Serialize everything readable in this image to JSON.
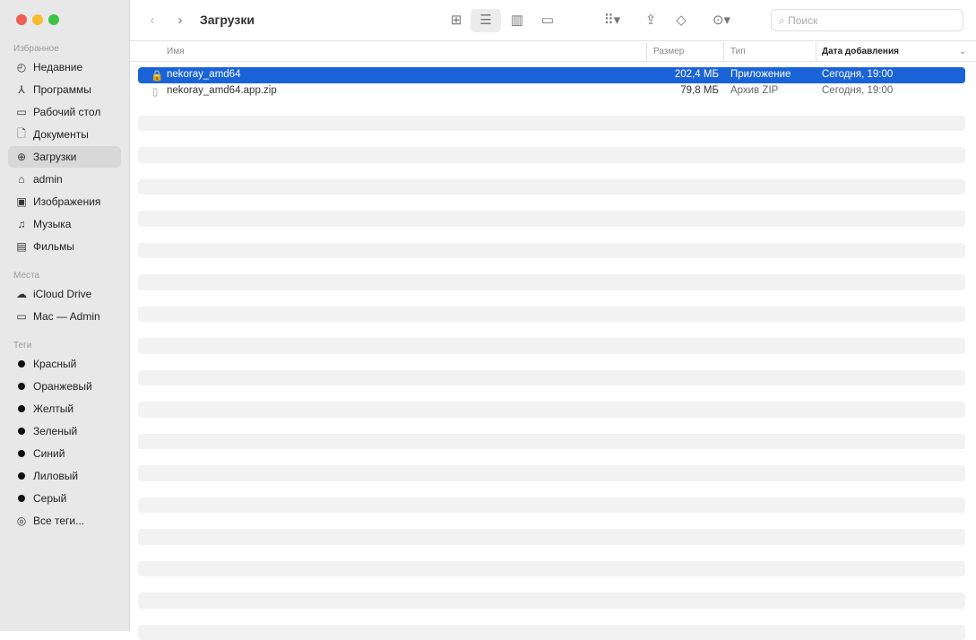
{
  "window": {
    "title": "Загрузки"
  },
  "sidebar": {
    "favorites_label": "Избранное",
    "favorites": [
      {
        "label": "Недавние",
        "icon": "clock-icon"
      },
      {
        "label": "Программы",
        "icon": "apps-icon"
      },
      {
        "label": "Рабочий стол",
        "icon": "desktop-icon"
      },
      {
        "label": "Документы",
        "icon": "document-icon"
      },
      {
        "label": "Загрузки",
        "icon": "download-icon",
        "selected": true
      },
      {
        "label": "admin",
        "icon": "home-icon"
      },
      {
        "label": "Изображения",
        "icon": "photo-icon"
      },
      {
        "label": "Музыка",
        "icon": "music-icon"
      },
      {
        "label": "Фильмы",
        "icon": "film-icon"
      }
    ],
    "places_label": "Места",
    "places": [
      {
        "label": "iCloud Drive",
        "icon": "cloud-icon"
      },
      {
        "label": "Mac — Admin",
        "icon": "computer-icon"
      }
    ],
    "tags_label": "Теги",
    "tags": [
      {
        "label": "Красный"
      },
      {
        "label": "Оранжевый"
      },
      {
        "label": "Желтый"
      },
      {
        "label": "Зеленый"
      },
      {
        "label": "Синий"
      },
      {
        "label": "Лиловый"
      },
      {
        "label": "Серый"
      }
    ],
    "all_tags": "Все теги..."
  },
  "toolbar": {
    "search_placeholder": "Поиск"
  },
  "columns": {
    "name": "Имя",
    "size": "Размер",
    "kind": "Тип",
    "date": "Дата добавления"
  },
  "files": [
    {
      "name": "nekoray_amd64",
      "size": "202,4 МБ",
      "kind": "Приложение",
      "date": "Сегодня, 19:00",
      "selected": true
    },
    {
      "name": "nekoray_amd64.app.zip",
      "size": "79,8 МБ",
      "kind": "Архив ZIP",
      "date": "Сегодня, 19:00"
    }
  ],
  "colors": {
    "selection": "#1a63d6"
  }
}
